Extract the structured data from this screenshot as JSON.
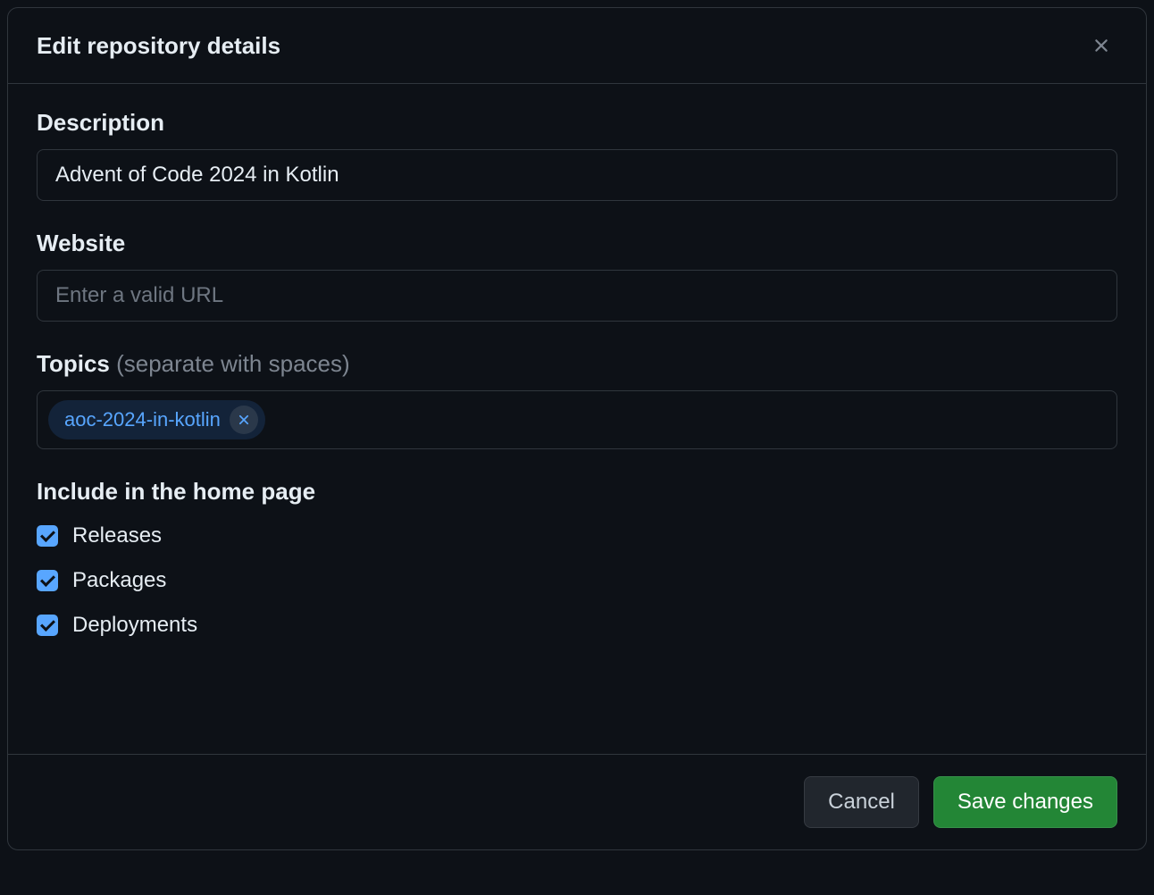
{
  "dialog": {
    "title": "Edit repository details",
    "description": {
      "label": "Description",
      "value": "Advent of Code 2024 in Kotlin"
    },
    "website": {
      "label": "Website",
      "placeholder": "Enter a valid URL",
      "value": ""
    },
    "topics": {
      "label": "Topics",
      "hint": "(separate with spaces)",
      "tags": [
        {
          "name": "aoc-2024-in-kotlin"
        }
      ]
    },
    "include": {
      "heading": "Include in the home page",
      "options": [
        {
          "label": "Releases",
          "checked": true
        },
        {
          "label": "Packages",
          "checked": true
        },
        {
          "label": "Deployments",
          "checked": true
        }
      ]
    },
    "footer": {
      "cancel": "Cancel",
      "save": "Save changes"
    }
  }
}
